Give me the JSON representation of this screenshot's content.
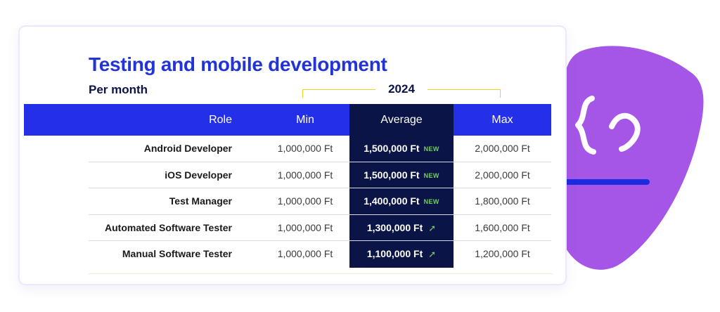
{
  "title": "Testing and mobile development",
  "subtitle": "Per month",
  "year": "2024",
  "columns": {
    "role": "Role",
    "min": "Min",
    "average": "Average",
    "max": "Max"
  },
  "rows": [
    {
      "role": "Android Developer",
      "min": "1,000,000 Ft",
      "average": "1,500,000 Ft",
      "marker": "NEW",
      "max": "2,000,000 Ft"
    },
    {
      "role": "iOS Developer",
      "min": "1,000,000 Ft",
      "average": "1,500,000 Ft",
      "marker": "NEW",
      "max": "2,000,000 Ft"
    },
    {
      "role": "Test Manager",
      "min": "1,000,000 Ft",
      "average": "1,400,000 Ft",
      "marker": "NEW",
      "max": "1,800,000 Ft"
    },
    {
      "role": "Automated Software Tester",
      "min": "1,000,000 Ft",
      "average": "1,300,000 Ft",
      "marker": "up-arrow-icon",
      "max": "1,600,000 Ft"
    },
    {
      "role": "Manual Software Tester",
      "min": "1,000,000 Ft",
      "average": "1,100,000 Ft",
      "marker": "up-arrow-icon",
      "max": "1,200,000 Ft"
    }
  ],
  "colors": {
    "title": "#2334d6",
    "header_bg": "#2430e8",
    "average_bg": "#0b1447",
    "accent_green": "#6ed15a",
    "blob": "#a656e6",
    "year_bracket": "#e6d51f"
  },
  "decor": {
    "blob_icon": "curly-braces-icon"
  }
}
